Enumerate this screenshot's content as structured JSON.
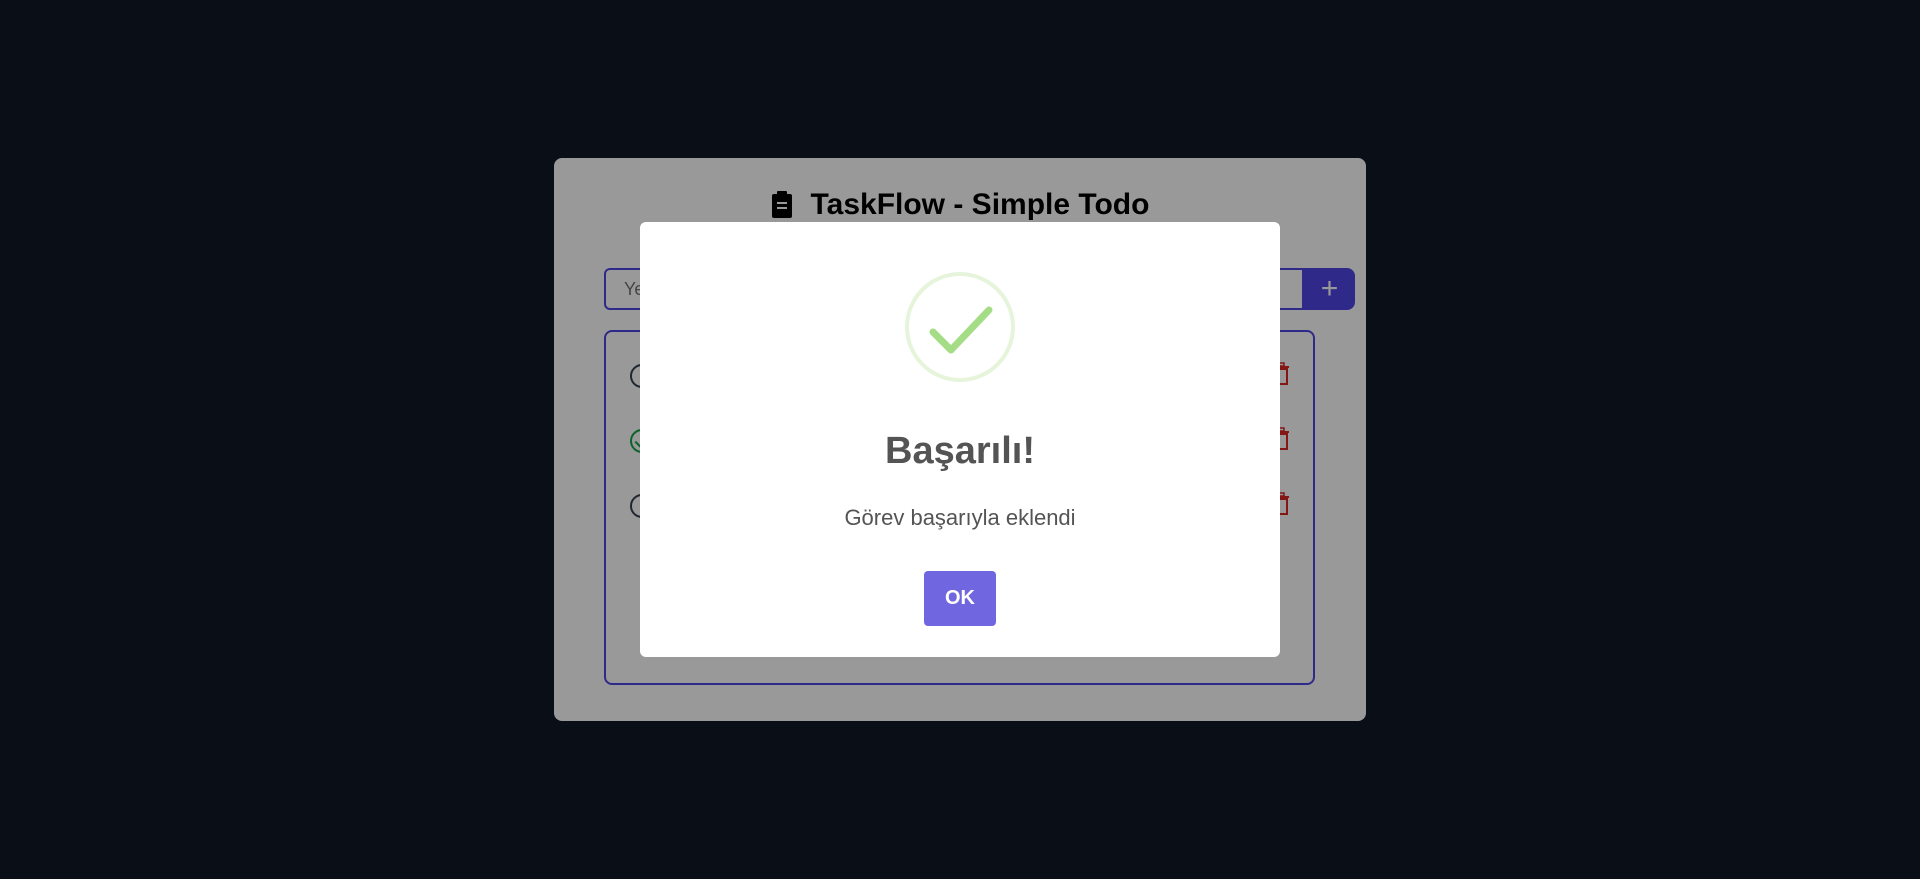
{
  "app": {
    "title": "TaskFlow - Simple Todo",
    "input_placeholder": "Yeni görev ekle...",
    "add_label": "+",
    "tasks": [
      {
        "done": false
      },
      {
        "done": true
      },
      {
        "done": false
      }
    ]
  },
  "modal": {
    "title": "Başarılı!",
    "message": "Görev başarıyla eklendi",
    "ok_label": "OK"
  },
  "colors": {
    "accent": "#4f46e5",
    "success": "#a5dc86",
    "confirm": "#7066e0",
    "delete": "#dc2626",
    "background": "#111827"
  }
}
